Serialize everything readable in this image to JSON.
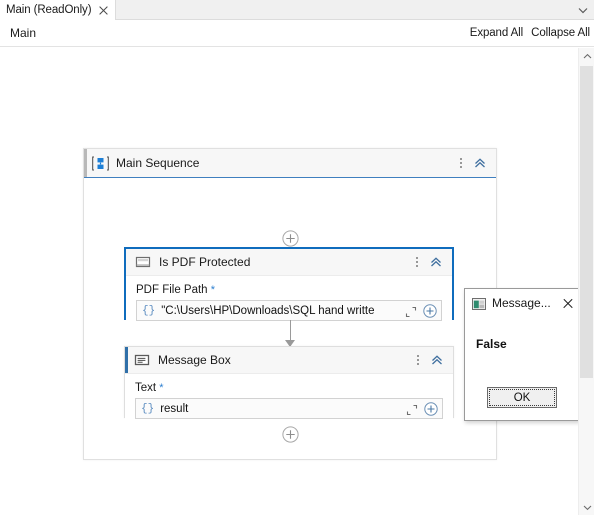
{
  "tabstrip": {
    "active_tab": "Main (ReadOnly)",
    "close_icon": "close-icon",
    "overflow_icon": "chevron-down-icon"
  },
  "commandbar": {
    "breadcrumb": "Main",
    "expand_all": "Expand All",
    "collapse_all": "Collapse All"
  },
  "sequence": {
    "title": "Main Sequence",
    "icon": "sequence-icon",
    "menu_icon": "kebab-menu-icon",
    "collapse_icon": "double-chevron-up-icon",
    "add_top_icon": "add-activity-icon",
    "add_bottom_icon": "add-activity-icon"
  },
  "activities": [
    {
      "title": "Is PDF Protected",
      "icon": "activity-icon",
      "selected": true,
      "menu_icon": "kebab-menu-icon",
      "collapse_icon": "double-chevron-up-icon",
      "field": {
        "label": "PDF File Path",
        "required_marker": "*",
        "value": "\"C:\\Users\\HP\\Downloads\\SQL hand writte",
        "prefix": "{}",
        "expand_icon": "open-expression-editor-icon",
        "plus_icon": "add-value-icon"
      }
    },
    {
      "title": "Message Box",
      "icon": "message-box-icon",
      "selected": false,
      "menu_icon": "kebab-menu-icon",
      "collapse_icon": "double-chevron-up-icon",
      "field": {
        "label": "Text",
        "required_marker": "*",
        "value": "result",
        "prefix": "{}",
        "expand_icon": "open-expression-editor-icon",
        "plus_icon": "add-value-icon"
      }
    }
  ],
  "dialog": {
    "title": "Message...",
    "icon": "app-window-icon",
    "close_icon": "close-icon",
    "message": "False",
    "ok_label": "OK"
  },
  "scrollbar": {
    "up_icon": "chevron-up-icon",
    "down_icon": "chevron-down-icon",
    "thumb": "scroll-thumb"
  },
  "colors": {
    "selection_blue": "#0f6cbd",
    "accent_blue": "#2c7fd0",
    "card_header": "#f7f7f7",
    "connector_gray": "#9a9a9a"
  }
}
